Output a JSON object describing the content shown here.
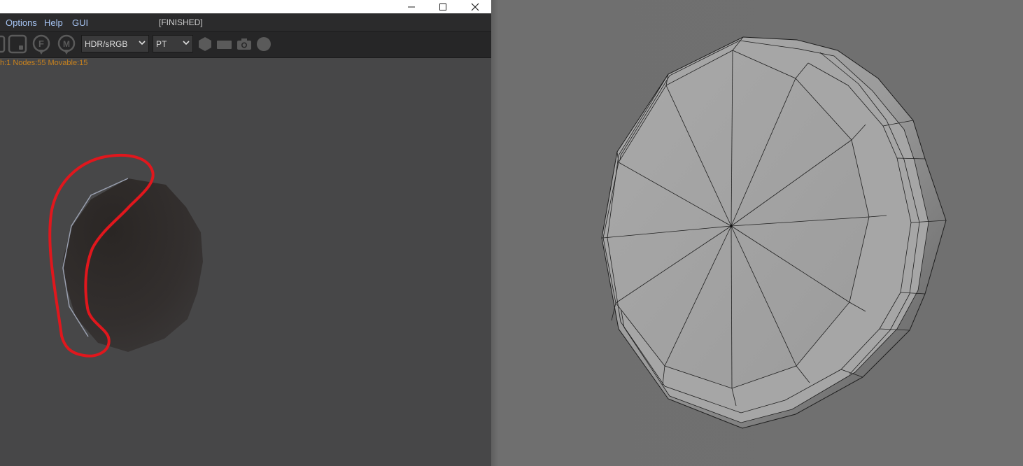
{
  "window": {
    "controls": {
      "minimize": "minimize-icon",
      "maximize": "maximize-icon",
      "close": "close-icon"
    }
  },
  "menubar": {
    "items": [
      "Options",
      "Help",
      "GUI"
    ],
    "status": "[FINISHED]"
  },
  "toolbar": {
    "icons": [
      "stop-icon",
      "frame-icon",
      "focus-icon",
      "move-icon"
    ],
    "color_mode": {
      "selected": "HDR/sRGB"
    },
    "render_mode": {
      "selected": "PT"
    },
    "shape_icons": [
      "hexagon-icon",
      "rectangle-icon",
      "camera-icon",
      "circle-icon"
    ]
  },
  "info": {
    "text": "h:1 Nodes:55 Movable:15"
  },
  "annotation": {
    "color": "#e0171d"
  },
  "colors": {
    "viewport_bg": "#474748",
    "menu_text": "#a5c3f2",
    "info_text": "#c8821e"
  }
}
